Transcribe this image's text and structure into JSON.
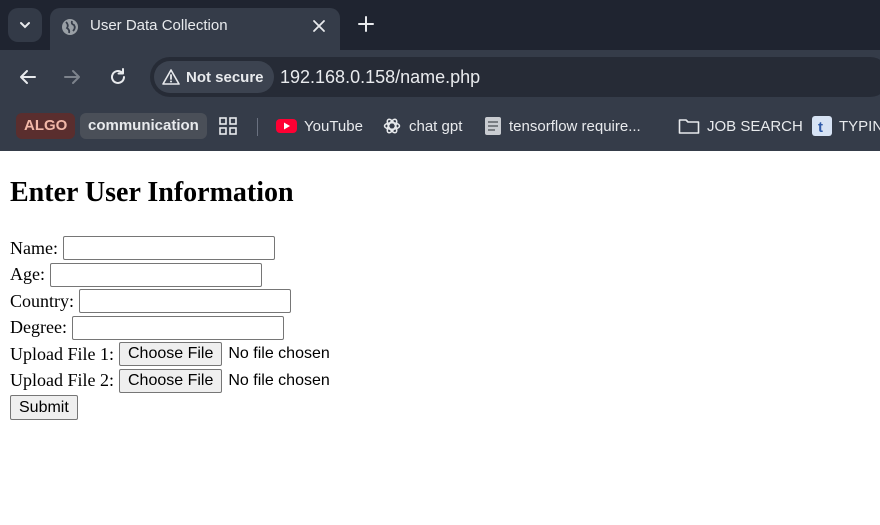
{
  "browser": {
    "tab_title": "User Data Collection",
    "security_label": "Not secure",
    "url": "192.168.0.158/name.php",
    "bookmarks": [
      {
        "label": "ALGO",
        "icon": "chip"
      },
      {
        "label": "communication",
        "icon": "chip"
      },
      {
        "label": "",
        "icon": "apps-grid-icon"
      },
      {
        "label": "YouTube",
        "icon": "youtube-icon"
      },
      {
        "label": "chat gpt",
        "icon": "openai-icon"
      },
      {
        "label": "tensorflow require...",
        "icon": "document-icon"
      },
      {
        "label": "JOB SEARCH",
        "icon": "folder-icon"
      },
      {
        "label": "TYPIN",
        "icon": "t-icon"
      }
    ]
  },
  "page": {
    "heading": "Enter User Information",
    "fields": [
      {
        "label": "Name:",
        "value": ""
      },
      {
        "label": "Age:",
        "value": ""
      },
      {
        "label": "Country:",
        "value": ""
      },
      {
        "label": "Degree:",
        "value": ""
      }
    ],
    "uploads": [
      {
        "label": "Upload File 1:",
        "button": "Choose File",
        "status": "No file chosen"
      },
      {
        "label": "Upload File 2:",
        "button": "Choose File",
        "status": "No file chosen"
      }
    ],
    "submit_label": "Submit"
  },
  "colors": {
    "chrome_dark": "#1f2430",
    "chrome": "#353c49",
    "algo_chip": "#5a2e2e",
    "algo_text": "#f2b8a8",
    "communication_chip": "#4a4f58",
    "youtube_red": "#ff0033"
  }
}
